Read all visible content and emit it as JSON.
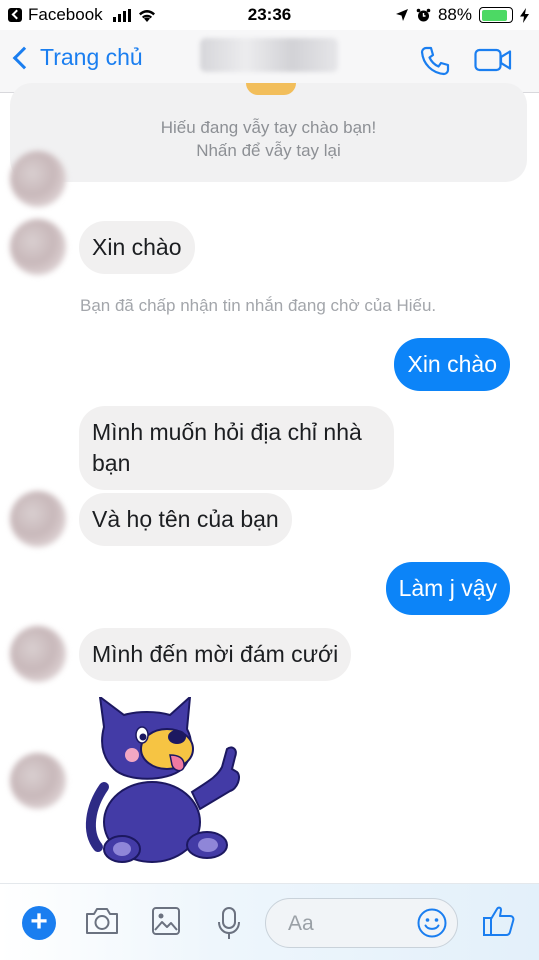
{
  "status_bar": {
    "app_back_label": "Facebook",
    "time": "23:36",
    "battery": "88%",
    "battery_level": 0.88
  },
  "header": {
    "back_label": "Trang chủ",
    "call_icon": "phone-icon",
    "video_icon": "video-camera-icon"
  },
  "wave_card": {
    "line1": "Hiếu đang vẫy tay chào bạn!",
    "line2": "Nhấn để vẫy tay lại"
  },
  "messages": [
    {
      "text": "Xin chào",
      "from": "them"
    },
    {
      "text": "Bạn đã chấp nhận tin nhắn đang chờ của Hiếu.",
      "from": "system"
    },
    {
      "text": "Xin chào",
      "from": "me"
    },
    {
      "text": "Mình muốn hỏi địa chỉ nhà bạn",
      "from": "them"
    },
    {
      "text": "Và họ tên của bạn",
      "from": "them"
    },
    {
      "text": "Làm j vậy",
      "from": "me"
    },
    {
      "text": "Mình đến mời đám cưới",
      "from": "them"
    }
  ],
  "composer": {
    "placeholder": "Aa",
    "icons": [
      "plus-icon",
      "camera-icon",
      "gallery-icon",
      "microphone-icon",
      "emoji-icon",
      "thumbs-up-icon"
    ]
  },
  "colors": {
    "accent": "#1a7ef0",
    "outgoing_bubble": "#0c84f8",
    "incoming_bubble": "#f1f0f0"
  }
}
